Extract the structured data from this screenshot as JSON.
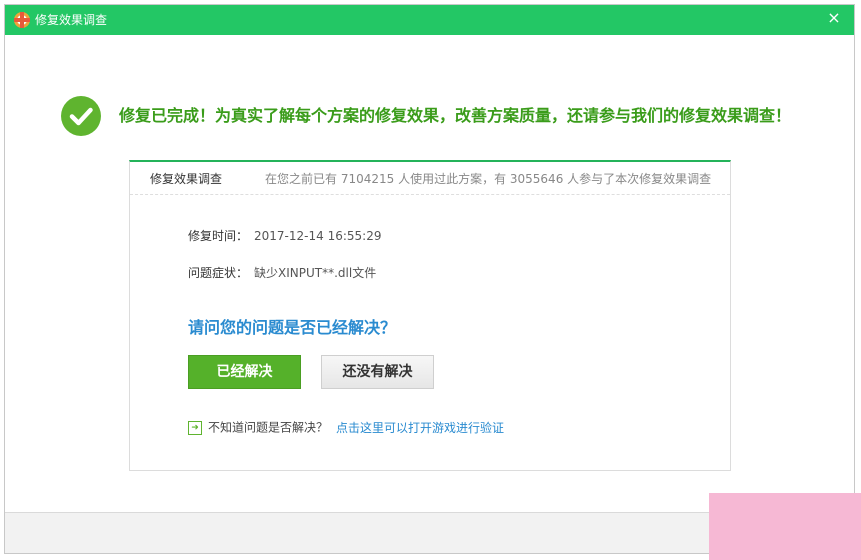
{
  "window": {
    "title": "修复效果调查",
    "close_glyph": "×"
  },
  "success": {
    "message": "修复已完成！为真实了解每个方案的修复效果，改善方案质量，还请参与我们的修复效果调查！"
  },
  "card": {
    "title": "修复效果调查",
    "stats": "在您之前已有 7104215 人使用过此方案，有 3055646 人参与了本次修复效果调查",
    "repair_time_label": "修复时间：",
    "repair_time_value": "2017-12-14 16:55:29",
    "symptom_label": "问题症状：",
    "symptom_value": "缺少XINPUT**.dll文件",
    "question": "请问您的问题是否已经解决？",
    "solved_button": "已经解决",
    "unsolved_button": "还没有解决",
    "verify_question": "不知道问题是否解决？",
    "verify_link": "点击这里可以打开游戏进行验证"
  },
  "colors": {
    "titlebar": "#23c765",
    "success_text": "#3a9c1a",
    "question_text": "#2a8bd0",
    "solved_button": "#55b12a"
  },
  "icons": {
    "app": "lifebuoy-icon",
    "success": "check-circle-icon",
    "verify": "arrow-right-box-icon",
    "close": "close-icon"
  }
}
